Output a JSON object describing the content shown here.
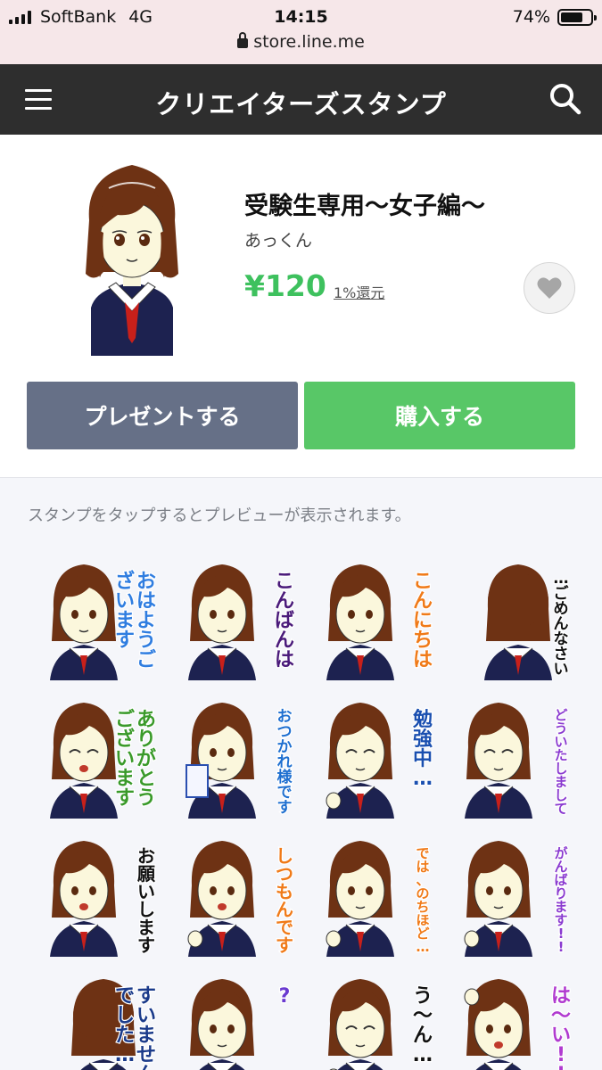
{
  "status_bar": {
    "carrier": "SoftBank",
    "network": "4G",
    "time": "14:15",
    "battery_text": "74%",
    "battery_level": 0.74,
    "url": "store.line.me"
  },
  "header": {
    "title": "クリエイターズスタンプ",
    "menu_icon": "hamburger-menu-icon",
    "search_icon": "search-icon"
  },
  "product": {
    "title": "受験生専用〜女子編〜",
    "author": "あっくん",
    "price": "¥120",
    "reward": "1%還元",
    "favorite_icon": "heart-icon",
    "gift_label": "プレゼントする",
    "buy_label": "購入する",
    "colors": {
      "price": "#3ec15e",
      "gift": "#667087",
      "buy": "#58c767",
      "header": "#2e2e2e"
    }
  },
  "preview": {
    "note": "スタンプをタップするとプレビューが表示されます。",
    "stickers": [
      {
        "caption": "おはようございます",
        "color": "#2f7de0",
        "pose": "face"
      },
      {
        "caption": "こんばんは",
        "color": "#4a1a7a",
        "pose": "face"
      },
      {
        "caption": "こんにちは",
        "color": "#f07a18",
        "pose": "face"
      },
      {
        "caption": "…ごめんなさい",
        "color": "#111111",
        "pose": "bow"
      },
      {
        "caption": "ありがとうございます",
        "color": "#3a9a2a",
        "pose": "cry"
      },
      {
        "caption": "おつかれ様です",
        "color": "#1e6fd0",
        "pose": "drink"
      },
      {
        "caption": "勉強中…",
        "color": "#1a4fb0",
        "pose": "study"
      },
      {
        "caption": "どういたしまして",
        "color": "#8a3ad0",
        "pose": "smile"
      },
      {
        "caption": "お願いします",
        "color": "#111111",
        "pose": "plead"
      },
      {
        "caption": "しつもんです",
        "color": "#f07a18",
        "pose": "hand"
      },
      {
        "caption": "では、のちほど…",
        "color": "#f07a18",
        "pose": "wave"
      },
      {
        "caption": "がんばります!!",
        "color": "#8a3ad0",
        "pose": "fist"
      },
      {
        "caption": "すいませんでした…",
        "color": "#1a3a8a",
        "pose": "bow"
      },
      {
        "caption": "?",
        "color": "#6a3ad0",
        "pose": "think"
      },
      {
        "caption": "う〜ん…",
        "color": "#111111",
        "pose": "study"
      },
      {
        "caption": "は〜い!!",
        "color": "#b03ad0",
        "pose": "raise"
      }
    ]
  }
}
